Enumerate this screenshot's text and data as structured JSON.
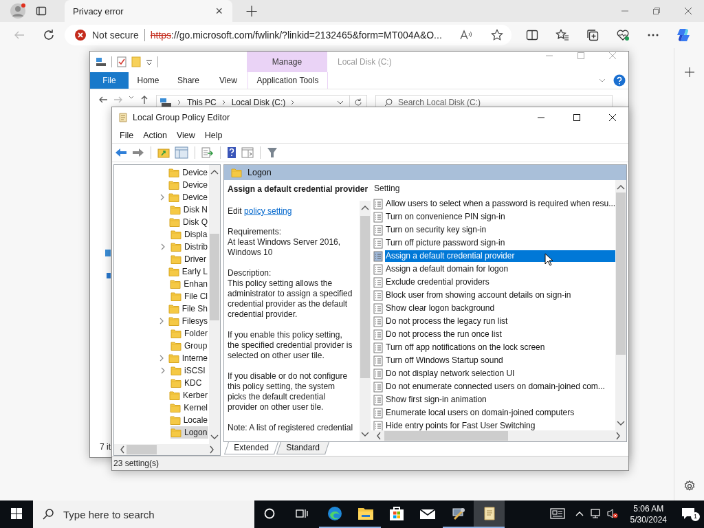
{
  "browser": {
    "tab": {
      "title": "Privacy error",
      "close": "×"
    },
    "new_tab": "+",
    "address": {
      "security": "Not secure",
      "scheme": "https",
      "rest": "://go.microsoft.com/fwlink/?linkid=2132465&form=MT004A&O..."
    }
  },
  "explorer": {
    "title": "Local Disk (C:)",
    "context_tab": "Manage",
    "ribbon_tabs": [
      {
        "label": "File",
        "selected": true
      },
      {
        "label": "Home",
        "selected": false
      },
      {
        "label": "Share",
        "selected": false
      },
      {
        "label": "View",
        "selected": false
      },
      {
        "label": "Application Tools",
        "selected": false
      }
    ],
    "breadcrumb": [
      "This PC",
      "Local Disk (C:)"
    ],
    "search": {
      "placeholder": "Search Local Disk (C:)"
    },
    "status": "7 it"
  },
  "gpe": {
    "title": "Local Group Policy Editor",
    "menu": [
      "File",
      "Action",
      "View",
      "Help"
    ],
    "tree": [
      {
        "label": "Device",
        "expandable": false,
        "selected": false
      },
      {
        "label": "Device",
        "expandable": false,
        "selected": false
      },
      {
        "label": "Device",
        "expandable": true,
        "selected": false
      },
      {
        "label": "Disk N",
        "expandable": false,
        "selected": false
      },
      {
        "label": "Disk Q",
        "expandable": false,
        "selected": false
      },
      {
        "label": "Displa",
        "expandable": false,
        "selected": false
      },
      {
        "label": "Distrib",
        "expandable": true,
        "selected": false
      },
      {
        "label": "Driver",
        "expandable": false,
        "selected": false
      },
      {
        "label": "Early L",
        "expandable": false,
        "selected": false
      },
      {
        "label": "Enhan",
        "expandable": false,
        "selected": false
      },
      {
        "label": "File Cl",
        "expandable": false,
        "selected": false
      },
      {
        "label": "File Sh",
        "expandable": false,
        "selected": false
      },
      {
        "label": "Filesys",
        "expandable": true,
        "selected": false
      },
      {
        "label": "Folder",
        "expandable": false,
        "selected": false
      },
      {
        "label": "Group",
        "expandable": false,
        "selected": false
      },
      {
        "label": "Interne",
        "expandable": true,
        "selected": false
      },
      {
        "label": "iSCSI",
        "expandable": true,
        "selected": false
      },
      {
        "label": "KDC",
        "expandable": false,
        "selected": false
      },
      {
        "label": "Kerber",
        "expandable": false,
        "selected": false
      },
      {
        "label": "Kernel",
        "expandable": false,
        "selected": false
      },
      {
        "label": "Locale",
        "expandable": false,
        "selected": false
      },
      {
        "label": "Logon",
        "expandable": false,
        "selected": true
      }
    ],
    "header": "Logon",
    "description": {
      "title": "Assign a default credential provider",
      "edit_prefix": "Edit",
      "edit_link": "policy setting",
      "sections": [
        "Requirements:\nAt least Windows Server 2016,\nWindows 10",
        "Description:\nThis policy setting allows the\nadministrator to assign a specified\ncredential provider as the default\ncredential provider.",
        "If you enable this policy setting,\nthe specified credential provider is\nselected on other user tile.",
        "If you disable or do not configure\nthis policy setting, the system\npicks the default credential\nprovider on other user tile.",
        "Note: A list of registered credential"
      ]
    },
    "settings": {
      "column": "Setting",
      "rows": [
        {
          "label": "Allow users to select when a password is required when resu...",
          "selected": false
        },
        {
          "label": "Turn on convenience PIN sign-in",
          "selected": false
        },
        {
          "label": "Turn on security key sign-in",
          "selected": false
        },
        {
          "label": "Turn off picture password sign-in",
          "selected": false
        },
        {
          "label": "Assign a default credential provider",
          "selected": true
        },
        {
          "label": "Assign a default domain for logon",
          "selected": false
        },
        {
          "label": "Exclude credential providers",
          "selected": false
        },
        {
          "label": "Block user from showing account details on sign-in",
          "selected": false
        },
        {
          "label": "Show clear logon background",
          "selected": false
        },
        {
          "label": "Do not process the legacy run list",
          "selected": false
        },
        {
          "label": "Do not process the run once list",
          "selected": false
        },
        {
          "label": "Turn off app notifications on the lock screen",
          "selected": false
        },
        {
          "label": "Turn off Windows Startup sound",
          "selected": false
        },
        {
          "label": "Do not display network selection UI",
          "selected": false
        },
        {
          "label": "Do not enumerate connected users on domain-joined com...",
          "selected": false
        },
        {
          "label": "Show first sign-in animation",
          "selected": false
        },
        {
          "label": "Enumerate local users on domain-joined computers",
          "selected": false
        },
        {
          "label": "Hide entry points for Fast User Switching",
          "selected": false
        }
      ]
    },
    "view_tabs": [
      {
        "label": "Extended",
        "selected": true
      },
      {
        "label": "Standard",
        "selected": false
      }
    ],
    "status": "23 setting(s)"
  },
  "taskbar": {
    "search": {
      "placeholder": "Type here to search"
    },
    "apps": [
      {
        "kind": "edge",
        "running": true,
        "active": false
      },
      {
        "kind": "folder",
        "running": true,
        "active": false
      },
      {
        "kind": "store",
        "running": false,
        "active": false
      },
      {
        "kind": "mail",
        "running": false,
        "active": false
      },
      {
        "kind": "tool",
        "running": true,
        "active": false
      },
      {
        "kind": "notepad",
        "running": true,
        "active": true
      }
    ],
    "time": "5:06 AM",
    "date": "5/30/2024",
    "notifications": "1"
  }
}
